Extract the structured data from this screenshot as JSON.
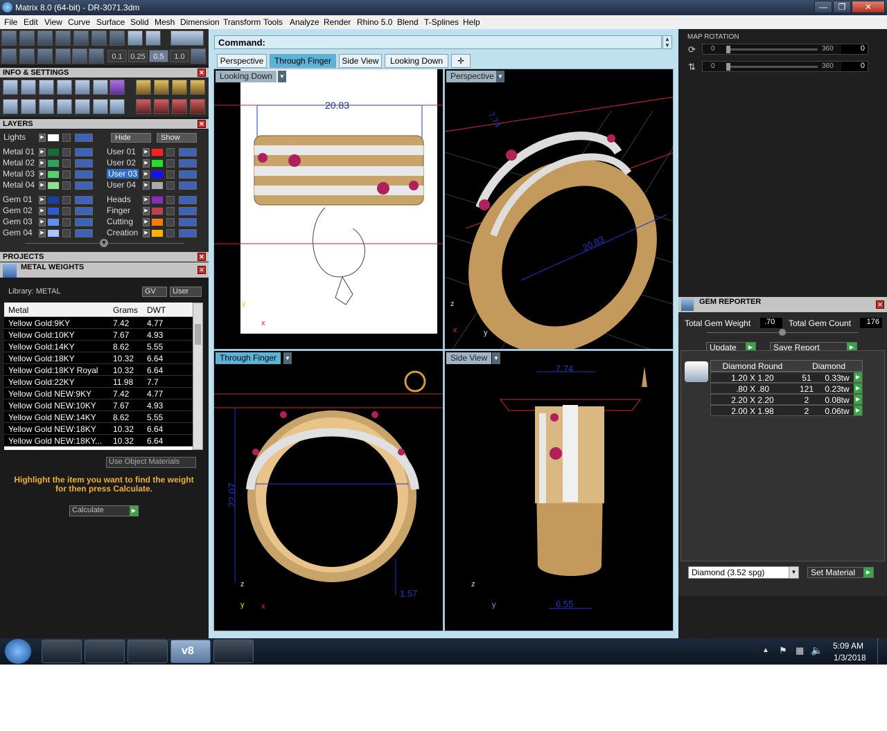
{
  "window": {
    "title": "Matrix 8.0 (64-bit) - DR-3071.3dm"
  },
  "menu": [
    "File",
    "Edit",
    "View",
    "Curve",
    "Surface",
    "Solid",
    "Mesh",
    "Dimension",
    "Transform",
    "Tools",
    "Analyze",
    "Render",
    "Rhino 5.0",
    "Blend",
    "T-Splines",
    "Help"
  ],
  "toolbar": {
    "snap_values": [
      "0.1",
      "0.25",
      "0.5",
      "1.0"
    ]
  },
  "info_settings": {
    "title": "INFO & SETTINGS"
  },
  "layers": {
    "title": "LAYERS",
    "lights": "Lights",
    "hide": "Hide",
    "show": "Show",
    "left": [
      {
        "name": "Metal 01",
        "color": "#1a6b3a"
      },
      {
        "name": "Metal 02",
        "color": "#2ea35a"
      },
      {
        "name": "Metal 03",
        "color": "#55d06b"
      },
      {
        "name": "Metal 04",
        "color": "#8fe08f"
      },
      {
        "name": "Gem 01",
        "color": "#1b3ca0"
      },
      {
        "name": "Gem 02",
        "color": "#2a5ed0"
      },
      {
        "name": "Gem 03",
        "color": "#5f8ff0"
      },
      {
        "name": "Gem 04",
        "color": "#a6c4ff"
      }
    ],
    "right": [
      {
        "name": "User 01",
        "color": "#ff2020"
      },
      {
        "name": "User 02",
        "color": "#22e022"
      },
      {
        "name": "User 03",
        "color": "#1010ff"
      },
      {
        "name": "User 04",
        "color": "#aaaaaa"
      },
      {
        "name": "Heads",
        "color": "#8b2bb8"
      },
      {
        "name": "Finger",
        "color": "#c04050"
      },
      {
        "name": "Cutting",
        "color": "#ff7a00"
      },
      {
        "name": "Creation",
        "color": "#ffb000"
      }
    ]
  },
  "projects": {
    "title": "PROJECTS"
  },
  "metal_weights": {
    "title": "METAL WEIGHTS",
    "library_label": "Library: METAL",
    "gv": "GV",
    "user": "User",
    "columns": [
      "Metal",
      "Grams",
      "DWT"
    ],
    "rows": [
      [
        "Yellow Gold:9KY",
        "7.42",
        "4.77"
      ],
      [
        "Yellow Gold:10KY",
        "7.67",
        "4.93"
      ],
      [
        "Yellow Gold:14KY",
        "8.62",
        "5.55"
      ],
      [
        "Yellow Gold:18KY",
        "10.32",
        "6.64"
      ],
      [
        "Yellow Gold:18KY Royal",
        "10.32",
        "6.64"
      ],
      [
        "Yellow Gold:22KY",
        "11.98",
        "7.7"
      ],
      [
        "Yellow Gold NEW:9KY",
        "7.42",
        "4.77"
      ],
      [
        "Yellow Gold NEW:10KY",
        "7.67",
        "4.93"
      ],
      [
        "Yellow Gold NEW:14KY",
        "8.62",
        "5.55"
      ],
      [
        "Yellow Gold NEW:18KY",
        "10.32",
        "6.64"
      ],
      [
        "Yellow Gold NEW:18KY...",
        "10.32",
        "6.64"
      ]
    ],
    "use_object_materials": "Use Object Materials",
    "hint": "Highlight the item you want to find the weight for then press Calculate.",
    "calculate": "Calculate"
  },
  "command": {
    "label": "Command:"
  },
  "view_tabs": [
    "Perspective",
    "Through Finger",
    "Side View",
    "Looking Down"
  ],
  "viewports": {
    "top_left": {
      "label": "Looking Down",
      "dim": "20.83"
    },
    "top_right": {
      "label": "Perspective",
      "dim1": "7.74",
      "dim2": "20.83"
    },
    "bottom_left": {
      "label": "Through Finger",
      "dim1": "22.07",
      "dim2": "1.57"
    },
    "bottom_right": {
      "label": "Side View",
      "dim1": "7.74",
      "dim2": "6.55"
    }
  },
  "map_rotation": {
    "title": "MAP ROTATION",
    "rows": [
      {
        "min": "0",
        "max": "360",
        "value": "0"
      },
      {
        "min": "0",
        "max": "360",
        "value": "0"
      }
    ]
  },
  "gem_reporter": {
    "title": "GEM REPORTER",
    "total_weight_label": "Total Gem Weight",
    "total_weight": ".70",
    "total_count_label": "Total Gem Count",
    "total_count": "176",
    "update": "Update",
    "save_report": "Save Report",
    "col1": "Diamond Round",
    "col2": "Diamond",
    "rows": [
      [
        "1.20 X 1.20",
        "51",
        "0.33tw"
      ],
      [
        ".80 X .80",
        "121",
        "0.23tw"
      ],
      [
        "2.20 X 2.20",
        "2",
        "0.08tw"
      ],
      [
        "2.00 X 1.98",
        "2",
        "0.06tw"
      ]
    ],
    "material": "Diamond     (3.52 spg)",
    "set_material": "Set Material"
  },
  "taskbar": {
    "time": "5:09 AM",
    "date": "1/3/2018",
    "app_label": "v8"
  }
}
